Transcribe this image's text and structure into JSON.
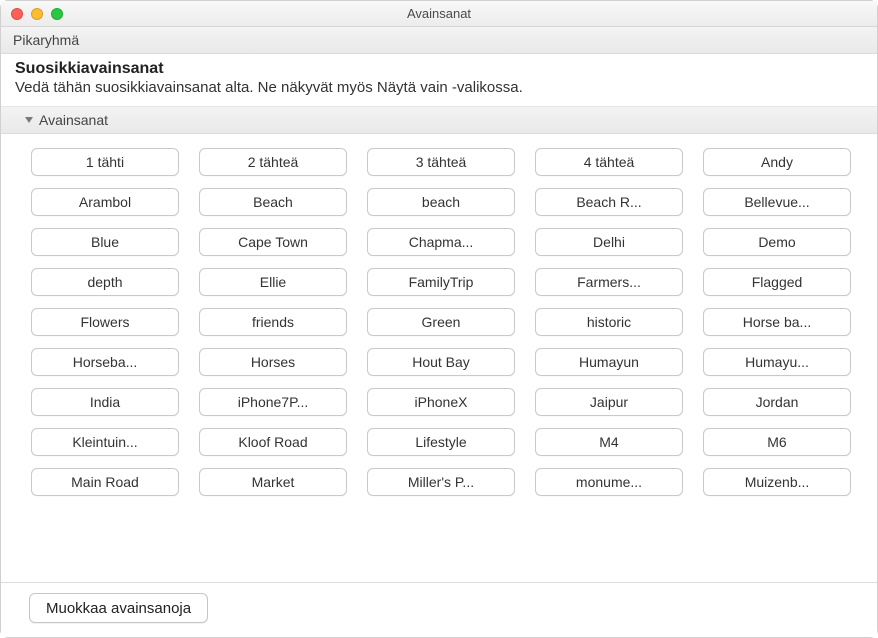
{
  "window": {
    "title": "Avainsanat"
  },
  "sections": {
    "quickgroup_label": "Pikaryhmä",
    "favorites_title": "Suosikkiavainsanat",
    "favorites_hint": "Vedä tähän suosikkiavainsanat alta. Ne näkyvät myös Näytä vain -valikossa.",
    "keywords_label": "Avainsanat"
  },
  "keywords": [
    "1 tähti",
    "2 tähteä",
    "3 tähteä",
    "4 tähteä",
    "Andy",
    "Arambol",
    "Beach",
    "beach",
    "Beach R...",
    "Bellevue...",
    "Blue",
    "Cape Town",
    "Chapma...",
    "Delhi",
    "Demo",
    "depth",
    "Ellie",
    "FamilyTrip",
    "Farmers...",
    "Flagged",
    "Flowers",
    "friends",
    "Green",
    "historic",
    "Horse ba...",
    "Horseba...",
    "Horses",
    "Hout Bay",
    "Humayun",
    "Humayu...",
    "India",
    "iPhone7P...",
    "iPhoneX",
    "Jaipur",
    "Jordan",
    "Kleintuin...",
    "Kloof Road",
    "Lifestyle",
    "M4",
    "M6",
    "Main Road",
    "Market",
    "Miller's P...",
    "monume...",
    "Muizenb..."
  ],
  "footer": {
    "edit_label": "Muokkaa avainsanoja"
  }
}
